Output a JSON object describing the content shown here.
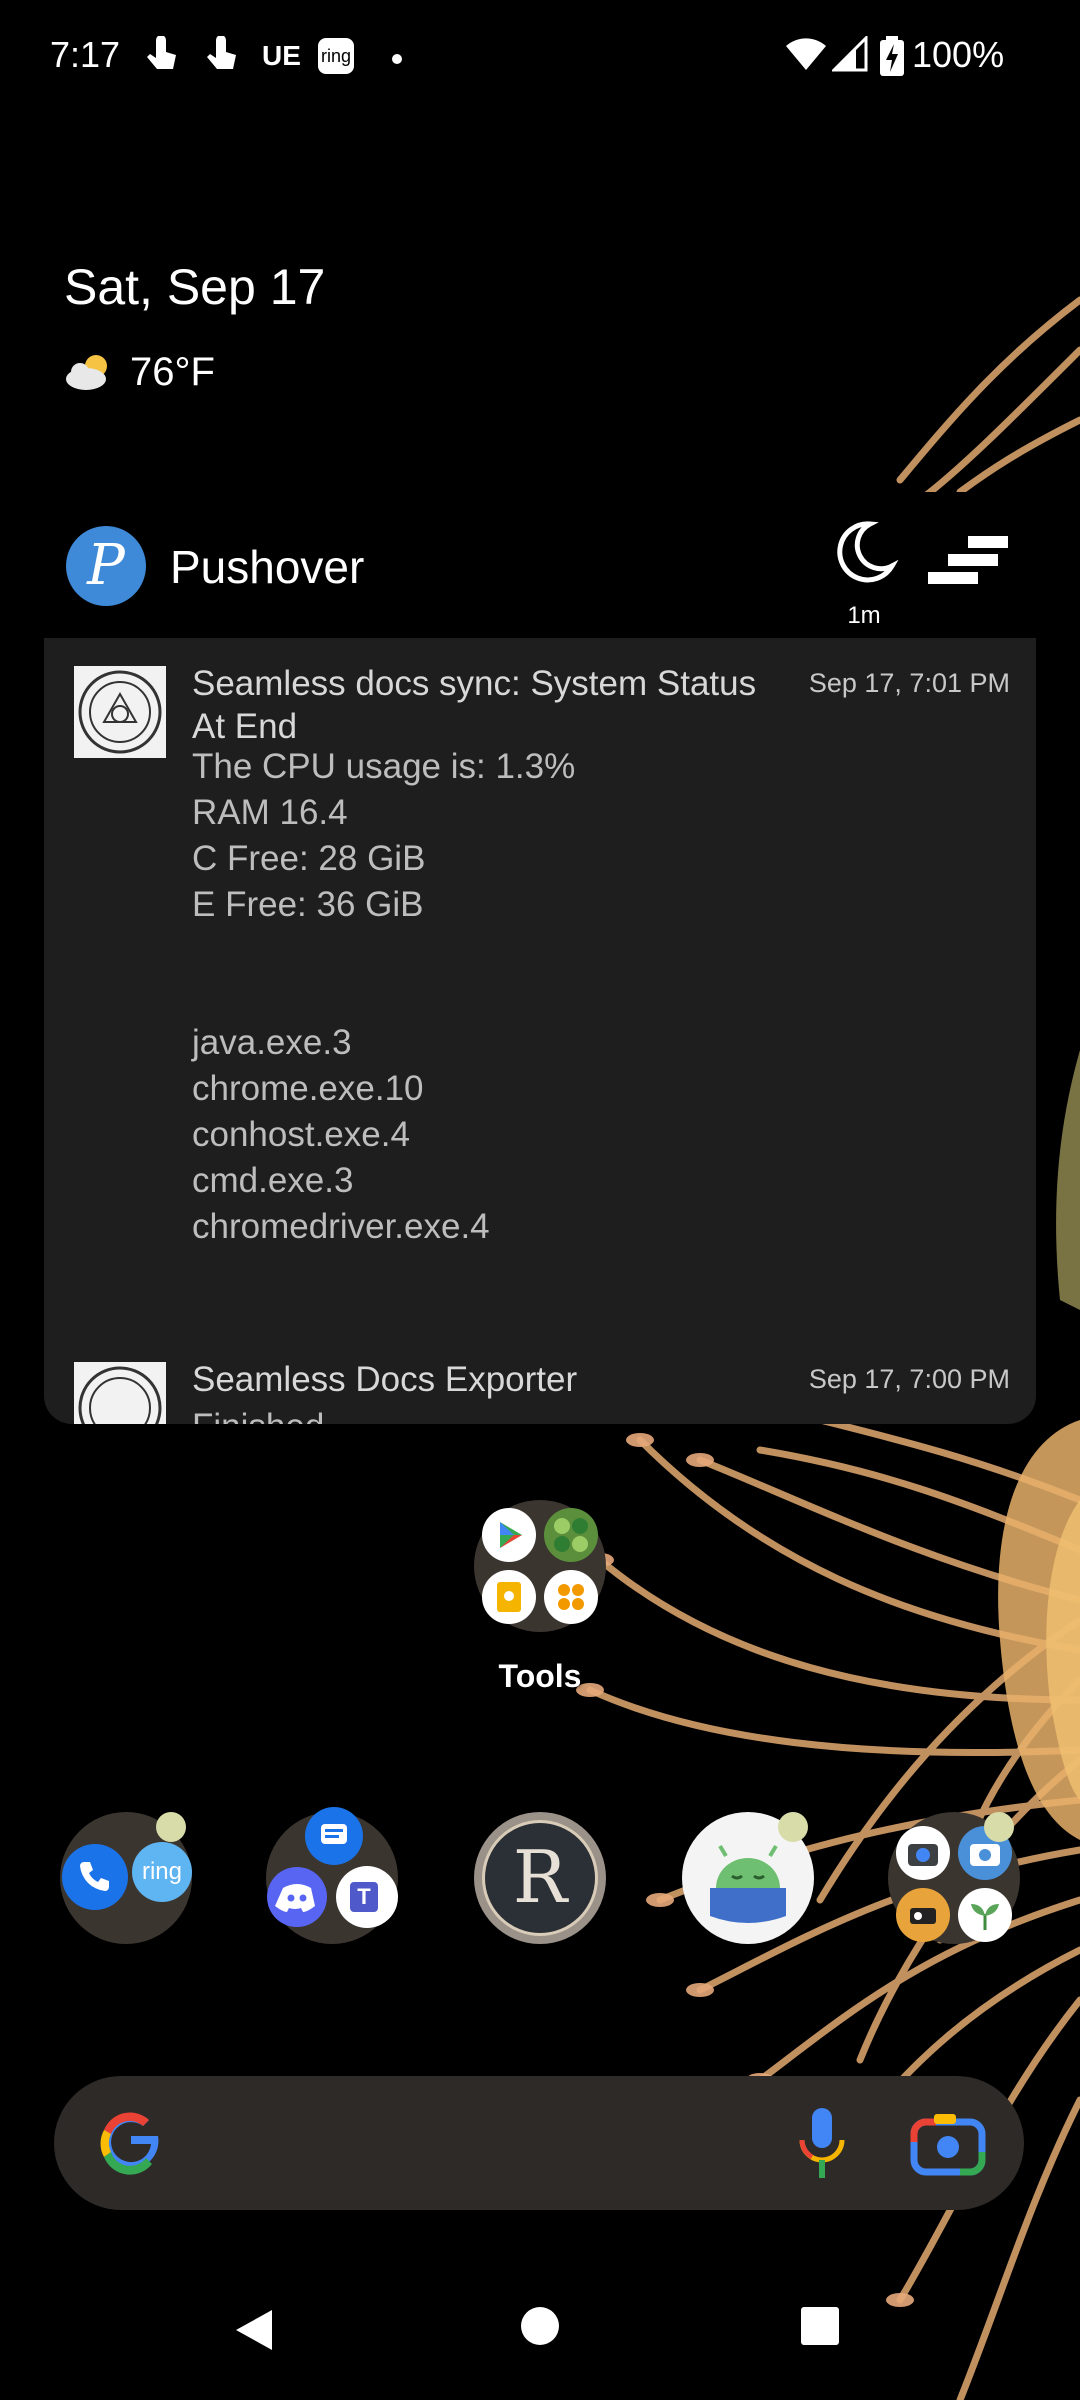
{
  "status_bar": {
    "time": "7:17",
    "carrier_label": "UE",
    "ring_label": "ring",
    "battery_percent": "100%",
    "battery_level": 1.0
  },
  "glance": {
    "date": "Sat, Sep 17",
    "temperature": "76°F",
    "weather_icon": "partly-cloudy-icon"
  },
  "pushover": {
    "app_name": "Pushover",
    "logo_letter": "P",
    "snooze_label": "1m",
    "brand_color": "#3f8ad8",
    "messages": [
      {
        "title_line1": "Seamless docs sync: System Status",
        "title_line2": "At End",
        "time": "Sep 17, 7:01 PM",
        "body": [
          "The CPU usage is: 1.3%",
          "RAM 16.4",
          "C Free: 28 GiB",
          "E Free: 36 GiB",
          "",
          "",
          "java.exe.3",
          "chrome.exe.10",
          "conhost.exe.4",
          "cmd.exe.3",
          "chromedriver.exe.4"
        ]
      },
      {
        "title_line1": "Seamless Docs Exporter",
        "title_line2": "",
        "time": "Sep 17, 7:00 PM",
        "body": [
          "Finished"
        ]
      }
    ]
  },
  "tools_folder": {
    "label": "Tools",
    "apps": [
      "play-store-icon",
      "network-tools-icon",
      "keep-notes-icon",
      "four-dots-icon"
    ]
  },
  "dock": [
    {
      "name": "phone-ring-folder",
      "apps": [
        "phone-icon",
        "ring-icon"
      ],
      "ring_label": "ring"
    },
    {
      "name": "messaging-folder",
      "apps": [
        "messages-icon",
        "discord-icon",
        "teams-icon"
      ],
      "teams_letter": "T"
    },
    {
      "name": "runescape-app",
      "letter": "R"
    },
    {
      "name": "sleep-as-android-app"
    },
    {
      "name": "camera-folder",
      "apps": [
        "camera-icon",
        "camera-alt-icon",
        "usb-camera-icon",
        "plant-icon"
      ]
    }
  ],
  "search": {
    "google_icon": "google-g-icon",
    "mic_icon": "microphone-icon",
    "lens_icon": "google-lens-icon"
  },
  "nav": [
    "back-button",
    "home-button",
    "recents-button"
  ]
}
